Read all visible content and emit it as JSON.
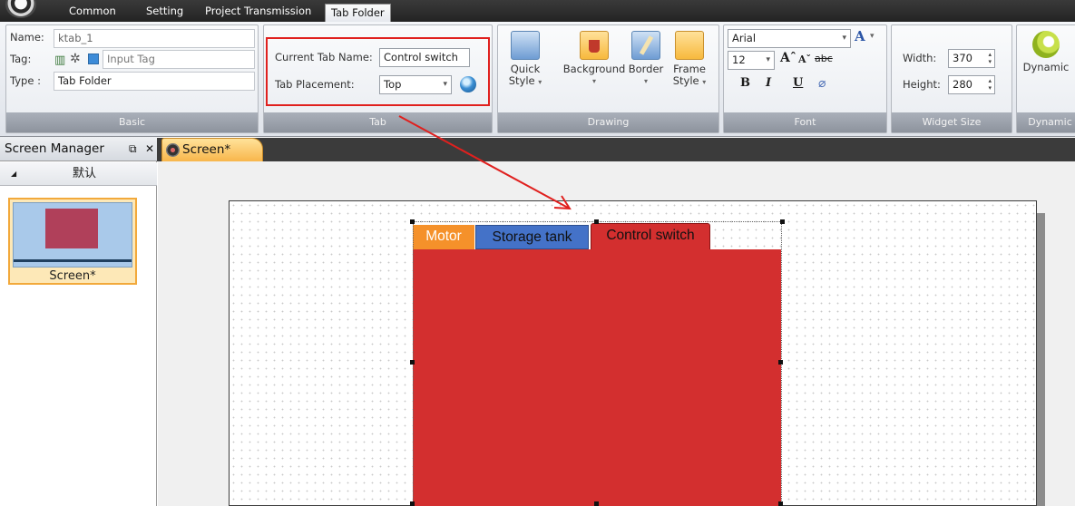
{
  "menu": {
    "tabs": [
      {
        "label": "Common"
      },
      {
        "label": "Setting"
      },
      {
        "label": "Project Transmission"
      },
      {
        "label": "Tab Folder"
      }
    ]
  },
  "ribbon": {
    "basic": {
      "name_label": "Name:",
      "name_value": "ktab_1",
      "tag_label": "Tag:",
      "tag_placeholder": "Input Tag",
      "type_label": "Type :",
      "type_value": "Tab Folder",
      "group_label": "Basic"
    },
    "tab": {
      "current_name_label": "Current Tab Name:",
      "current_name_value": "Control switch",
      "placement_label": "Tab Placement:",
      "placement_value": "Top",
      "group_label": "Tab"
    },
    "drawing": {
      "quick_style_1": "Quick",
      "quick_style_2": "Style",
      "background": "Background",
      "border": "Border",
      "frame_style_1": "Frame",
      "frame_style_2": "Style",
      "group_label": "Drawing"
    },
    "font": {
      "family_value": "Arial",
      "size_value": "12",
      "group_label": "Font"
    },
    "widget_size": {
      "width_label": "Width:",
      "width_value": "370",
      "height_label": "Height:",
      "height_value": "280",
      "group_label": "Widget Size"
    },
    "dynamic": {
      "button_label": "Dynamic",
      "group_label": "Dynamic"
    }
  },
  "screen_manager": {
    "title": "Screen Manager",
    "group_name": "默认",
    "screens": [
      {
        "label": "Screen*"
      }
    ]
  },
  "document": {
    "tab_label": "Screen*"
  },
  "tab_folder": {
    "tabs": [
      {
        "label": "Motor",
        "color": "#f5912a"
      },
      {
        "label": "Storage tank",
        "color": "#4472c8"
      },
      {
        "label": "Control switch",
        "color": "#d32f2f"
      }
    ],
    "active_tab": "Control switch"
  },
  "colors": {
    "highlight_box": "#e0201e",
    "tab_body": "#d32f2f"
  }
}
